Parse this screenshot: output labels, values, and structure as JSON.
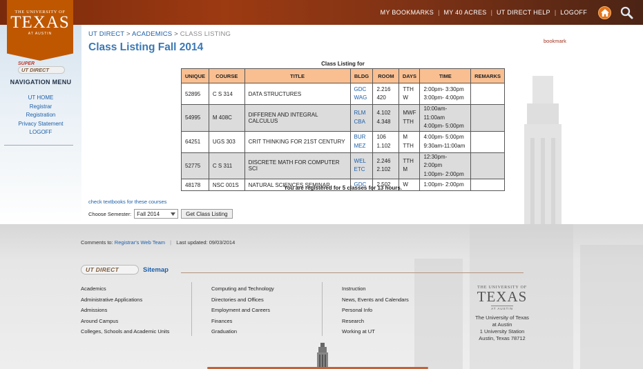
{
  "header": {
    "nav": [
      "MY BOOKMARKS",
      "MY 40 ACRES",
      "UT DIRECT HELP",
      "LOGOFF"
    ],
    "home_icon": "home-icon",
    "search_icon": "search-icon"
  },
  "logo": {
    "line1": "THE UNIVERSITY OF",
    "line2": "TEXAS",
    "line3": "AT AUSTIN"
  },
  "sidebar": {
    "super_label": "SUPER",
    "utdirect_label": "UT DIRECT",
    "title": "NAVIGATION MENU",
    "items": [
      "UT HOME",
      "Registrar",
      "Registration",
      "Privacy Statement",
      "LOGOFF"
    ]
  },
  "breadcrumb": {
    "items": [
      "UT DIRECT",
      "ACADEMICS"
    ],
    "separator": ">",
    "current": "CLASS LISTING"
  },
  "page": {
    "title": "Class Listing Fall 2014",
    "bookmark": "bookmark"
  },
  "table": {
    "caption": "Class Listing for",
    "headers": [
      "UNIQUE",
      "COURSE",
      "TITLE",
      "BLDG",
      "ROOM",
      "DAYS",
      "TIME",
      "REMARKS"
    ],
    "rows": [
      {
        "unique": "52895",
        "course": "C S 314",
        "title": "DATA STRUCTURES",
        "bldg": [
          "GDC",
          "WAG"
        ],
        "room": [
          "2.216",
          "420"
        ],
        "days": [
          "TTH",
          "W"
        ],
        "time": [
          "2:00pm- 3:30pm",
          "3:00pm- 4:00pm"
        ],
        "remarks": ""
      },
      {
        "unique": "54995",
        "course": "M 408C",
        "title": "DIFFEREN AND INTEGRAL CALCULUS",
        "bldg": [
          "RLM",
          "CBA"
        ],
        "room": [
          "4.102",
          "4.348"
        ],
        "days": [
          "MWF",
          "TTH"
        ],
        "time": [
          "10:00am-11:00am",
          "4:00pm- 5:00pm"
        ],
        "remarks": ""
      },
      {
        "unique": "64251",
        "course": "UGS 303",
        "title": "CRIT THINKING FOR 21ST CENTURY",
        "bldg": [
          "BUR",
          "MEZ"
        ],
        "room": [
          "106",
          "1.102"
        ],
        "days": [
          "M",
          "TTH"
        ],
        "time": [
          "4:00pm- 5:00pm",
          "9:30am-11:00am"
        ],
        "remarks": ""
      },
      {
        "unique": "52775",
        "course": "C S 311",
        "title": "DISCRETE MATH FOR COMPUTER SCI",
        "bldg": [
          "WEL",
          "ETC"
        ],
        "room": [
          "2.246",
          "2.102"
        ],
        "days": [
          "TTH",
          "M"
        ],
        "time": [
          "12:30pm- 2:00pm",
          "1:00pm- 2:00pm"
        ],
        "remarks": ""
      },
      {
        "unique": "48178",
        "course": "NSC 001S",
        "title": "NATURAL SCIENCES SEMINAR",
        "bldg": [
          "GDC"
        ],
        "room": [
          "2.502"
        ],
        "days": [
          "W"
        ],
        "time": [
          "1:00pm- 2:00pm"
        ],
        "remarks": ""
      }
    ],
    "summary": "You are registered for 5 classes for 13 hours."
  },
  "textbooks_link": "check textbooks for these courses",
  "semester": {
    "label": "Choose Semester:",
    "selected": "Fall 2014",
    "button": "Get Class Listing"
  },
  "footer": {
    "comments_label": "Comments to:",
    "comments_link": "Registrar's Web Team",
    "sep": "|",
    "last_updated": "Last updated: 09/03/2014",
    "utdirect_label": "UT DIRECT",
    "sitemap_title": "Sitemap",
    "col1": [
      "Academics",
      "Administrative Applications",
      "Admissions",
      "Around Campus",
      "Colleges, Schools and Academic Units"
    ],
    "col2": [
      "Computing and Technology",
      "Directories and Offices",
      "Employment and Careers",
      "Finances",
      "Graduation"
    ],
    "col3": [
      "Instruction",
      "News, Events and Calendars",
      "Personal Info",
      "Research",
      "Working at UT"
    ],
    "logo": {
      "line1": "THE UNIVERSITY OF",
      "line2": "TEXAS",
      "line3": "AT AUSTIN"
    },
    "address": [
      "The University of Texas",
      "at Austin",
      "1 University Station",
      "Austin, Texas 78712"
    ]
  },
  "colors": {
    "burnt_orange": "#bf5700",
    "header_bg": "#9c3a12",
    "table_header": "#f9bf91",
    "link_blue": "#1d5fa8",
    "title_blue": "#3b78b5"
  }
}
